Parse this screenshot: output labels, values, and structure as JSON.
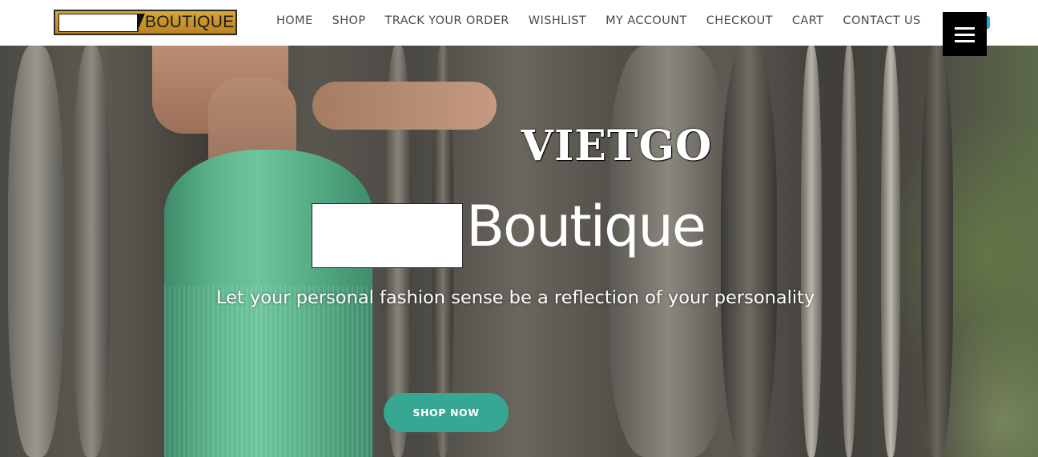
{
  "header": {
    "logo_text": "BOUTIQUE",
    "nav": [
      {
        "label": "HOME"
      },
      {
        "label": "SHOP"
      },
      {
        "label": "TRACK YOUR ORDER"
      },
      {
        "label": "WISHLIST"
      },
      {
        "label": "MY ACCOUNT"
      },
      {
        "label": "CHECKOUT"
      },
      {
        "label": "CART"
      },
      {
        "label": "CONTACT US"
      }
    ],
    "menu_icon": "hamburger-menu-icon"
  },
  "hero": {
    "watermark_title": "VIETGO",
    "brand_text": "Boutique",
    "tagline": "Let your personal fashion sense be a reflection of your personality",
    "cta_label": "SHOP NOW"
  },
  "colors": {
    "cta_bg": "#37a794",
    "logo_bg": "#c8922c",
    "hamburger_bg": "#000000",
    "nav_text": "#4a4a4a",
    "cart_badge": "#2aa3e0"
  }
}
